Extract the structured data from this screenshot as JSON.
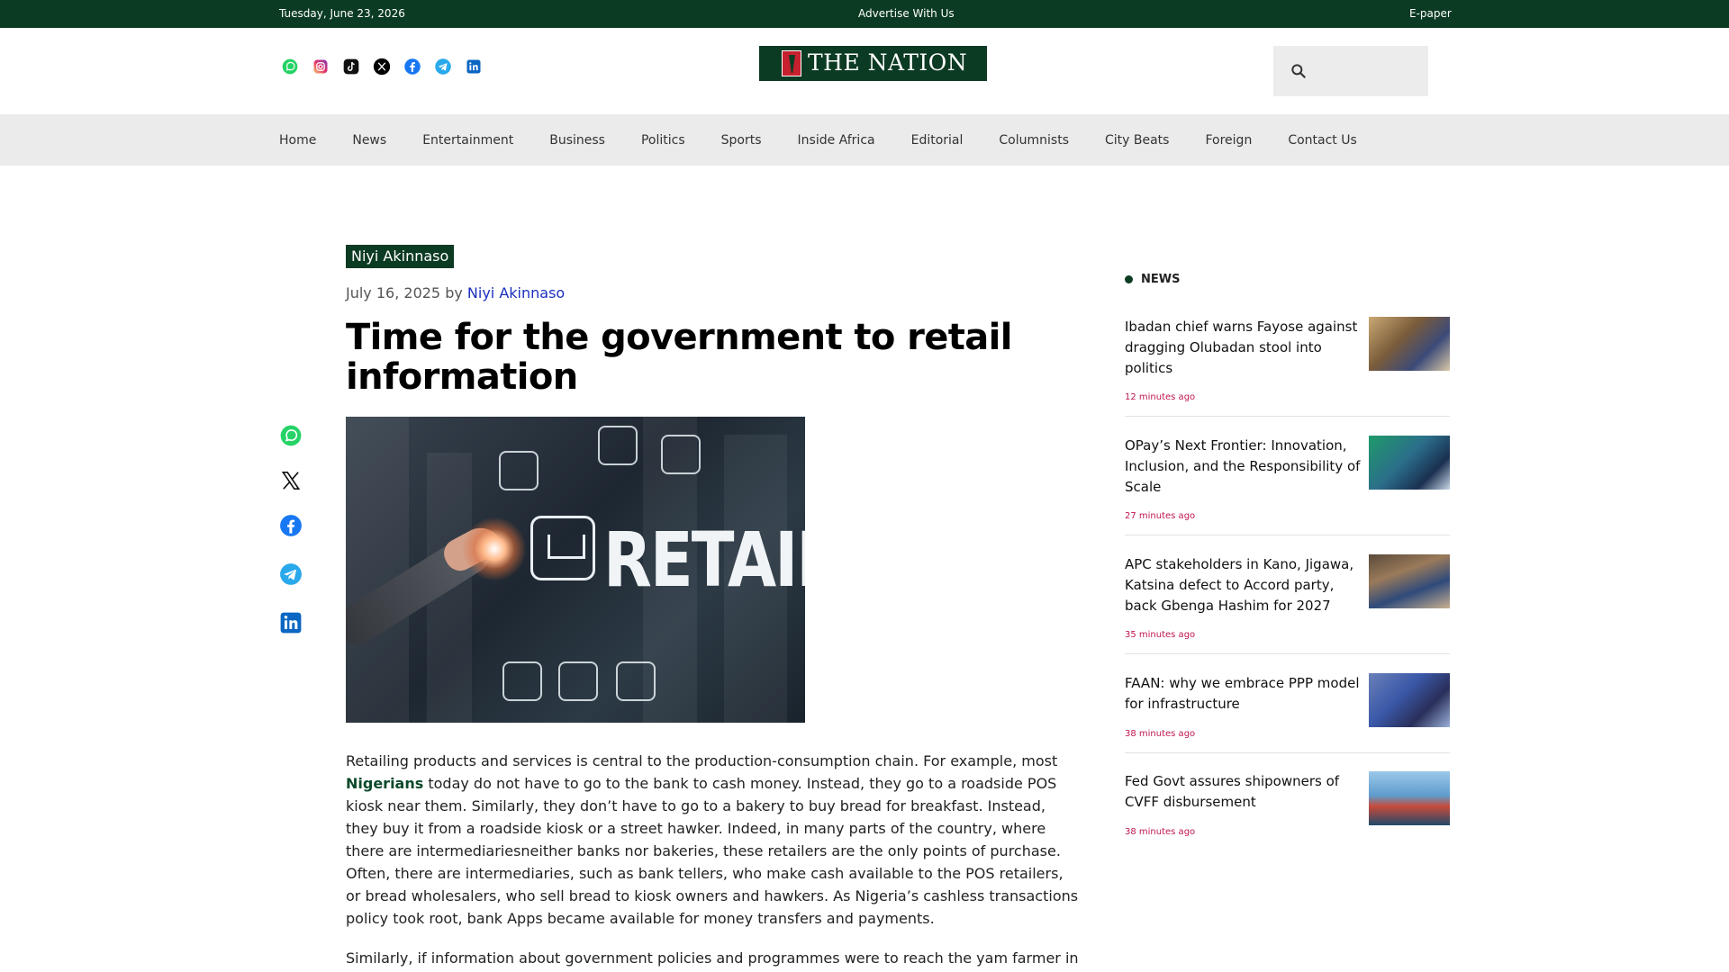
{
  "topbar": {
    "date": "Tuesday, June 23, 2026",
    "advertise": "Advertise With Us",
    "epaper": "E-paper"
  },
  "header": {
    "socials": [
      "whatsapp-icon",
      "instagram-icon",
      "tiktok-icon",
      "x-icon",
      "facebook-icon",
      "telegram-icon",
      "linkedin-icon"
    ],
    "logo_text": "THE NATION",
    "search_placeholder": ""
  },
  "nav": {
    "items": [
      "Home",
      "News",
      "Entertainment",
      "Business",
      "Politics",
      "Sports",
      "Inside Africa",
      "Editorial",
      "Columnists",
      "City Beats",
      "Foreign",
      "Contact Us"
    ]
  },
  "share": [
    "whatsapp-icon",
    "x-icon",
    "facebook-icon",
    "telegram-icon",
    "linkedin-icon"
  ],
  "article": {
    "category": "Niyi Akinnaso",
    "date": "July 16, 2025",
    "by": "by",
    "author": "Niyi Akinnaso",
    "title": "Time for the government to retail information",
    "image_word": "RETAIL",
    "p1_a": "Retailing products and services is central to the production-consumption chain. For example, most ",
    "p1_kw": "Nigerians",
    "p1_b": " today do not have to go to the bank to cash money. Instead, they go to a roadside POS kiosk near them. Similarly, they don’t have to go to a bakery to buy bread for breakfast. Instead, they buy it from a roadside kiosk or a street hawker. Indeed, in many parts of the country, where there are intermediariesneither banks nor bakeries, these retailers are the only points of purchase. Often, there are intermediaries, such as bank tellers, who make cash available to the POS retailers, or bread wholesalers, who sell bread to kiosk owners and hawkers. As Nigeria’s cashless transactions policy took root, bank Apps became available for money transfers and payments.",
    "p2": "Similarly, if information about government policies and programmes were to reach the yam farmer in"
  },
  "sidebar": {
    "heading": "NEWS",
    "items": [
      {
        "title": "Ibadan chief warns Fayose against dragging Olubadan stool into politics",
        "time": "12 minutes ago"
      },
      {
        "title": "OPay’s Next Frontier: Innovation, Inclusion, and the Responsibility of Scale",
        "time": "27 minutes ago"
      },
      {
        "title": "APC stakeholders in Kano, Jigawa, Katsina defect to Accord party, back Gbenga Hashim for 2027",
        "time": "35 minutes ago"
      },
      {
        "title": "FAAN: why we embrace PPP model for infrastructure",
        "time": "38 minutes ago"
      },
      {
        "title": "Fed Govt assures shipowners of CVFF disbursement",
        "time": "38 minutes ago"
      }
    ]
  },
  "colors": {
    "brand_green": "#0c3b23",
    "link_blue": "#1a2fbf",
    "time_red": "#c0164e"
  }
}
